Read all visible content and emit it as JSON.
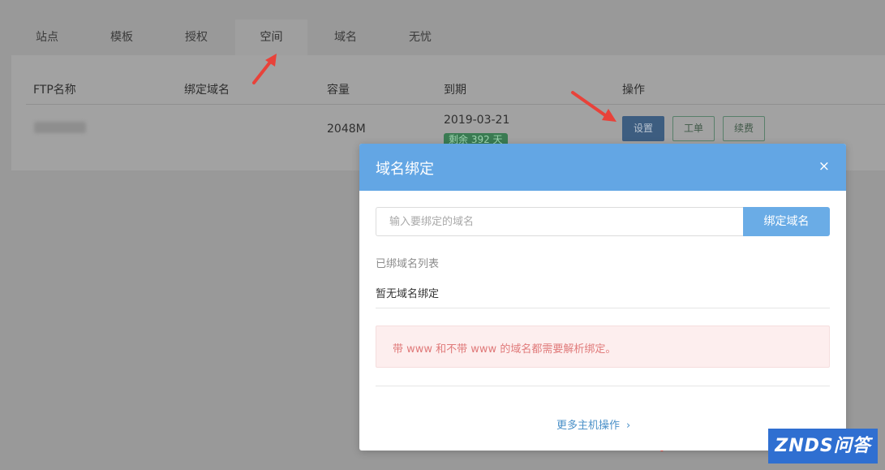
{
  "tabs": [
    {
      "label": "站点"
    },
    {
      "label": "模板"
    },
    {
      "label": "授权"
    },
    {
      "label": "空间"
    },
    {
      "label": "域名"
    },
    {
      "label": "无忧"
    }
  ],
  "active_tab": "空间",
  "table": {
    "headers": [
      "FTP名称",
      "绑定域名",
      "容量",
      "到期",
      "操作"
    ],
    "row": {
      "capacity": "2048M",
      "expiry_date": "2019-03-21",
      "remaining": "剩余 392 天",
      "actions": [
        "设置",
        "工单",
        "续费"
      ]
    }
  },
  "modal": {
    "title": "域名绑定",
    "close": "×",
    "input_placeholder": "输入要绑定的域名",
    "bind_button": "绑定域名",
    "list_title": "已绑域名列表",
    "empty_text": "暂无域名绑定",
    "alert_text": "带 www 和不带 www 的域名都需要解析绑定。",
    "more_link": "更多主机操作",
    "more_chevron": "›"
  },
  "watermark": {
    "text": "ZNDS问答"
  },
  "colors": {
    "modal_header": "#63a6e4",
    "bind_button": "#6aace6",
    "alert_bg": "#fdeeee",
    "alert_text": "#e07a7a",
    "arrow": "#e8423a",
    "watermark": "#2f6fd1"
  },
  "icons": [
    "close-icon",
    "chevron-right-icon",
    "red-arrow-annotation"
  ]
}
